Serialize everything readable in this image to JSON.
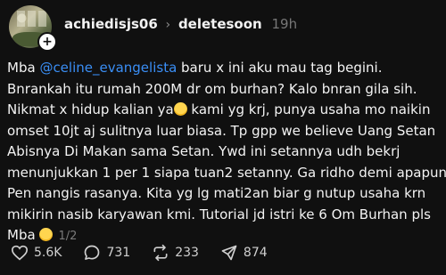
{
  "post": {
    "username": "achiedisjs06",
    "reply_to": "deletesoon",
    "time": "19h",
    "lines": [
      [
        "Mba ",
        "@celine_evangelista",
        " baru x ini aku mau tag begini."
      ],
      [
        "Bnrankah itu rumah 200M dr om burhan? Kalo bnran gila sih."
      ],
      [
        "Nikmat x hidup kalian ya",
        " kami yg krj, punya usaha mo naikin"
      ],
      [
        "omset 10jt aj sulitnya luar biasa. Tp gpp we believe Uang Setan"
      ],
      [
        "Abisnya Di Makan sama Setan. Ywd ini setannya udh bekrj"
      ],
      [
        "menunjukkan 1 per 1 siapa tuan2 setanny. Ga ridho demi apapun."
      ],
      [
        "Pen nangis rasanya. Kita yg lg mati2an biar g nutup usaha krn"
      ],
      [
        "mikirin nasib karyawan kmi. Tutorial jd istri ke 6 Om Burhan pls"
      ],
      [
        "Mba "
      ]
    ],
    "page_indicator": "1/2"
  },
  "actions": {
    "likes": "5.6K",
    "comments": "731",
    "reposts": "233",
    "shares": "874"
  },
  "icons": [
    "avatar",
    "follow-plus-icon",
    "chevron-right-icon",
    "more-icon",
    "emoji-icon",
    "heart-icon",
    "comment-icon",
    "repost-icon",
    "share-icon"
  ]
}
